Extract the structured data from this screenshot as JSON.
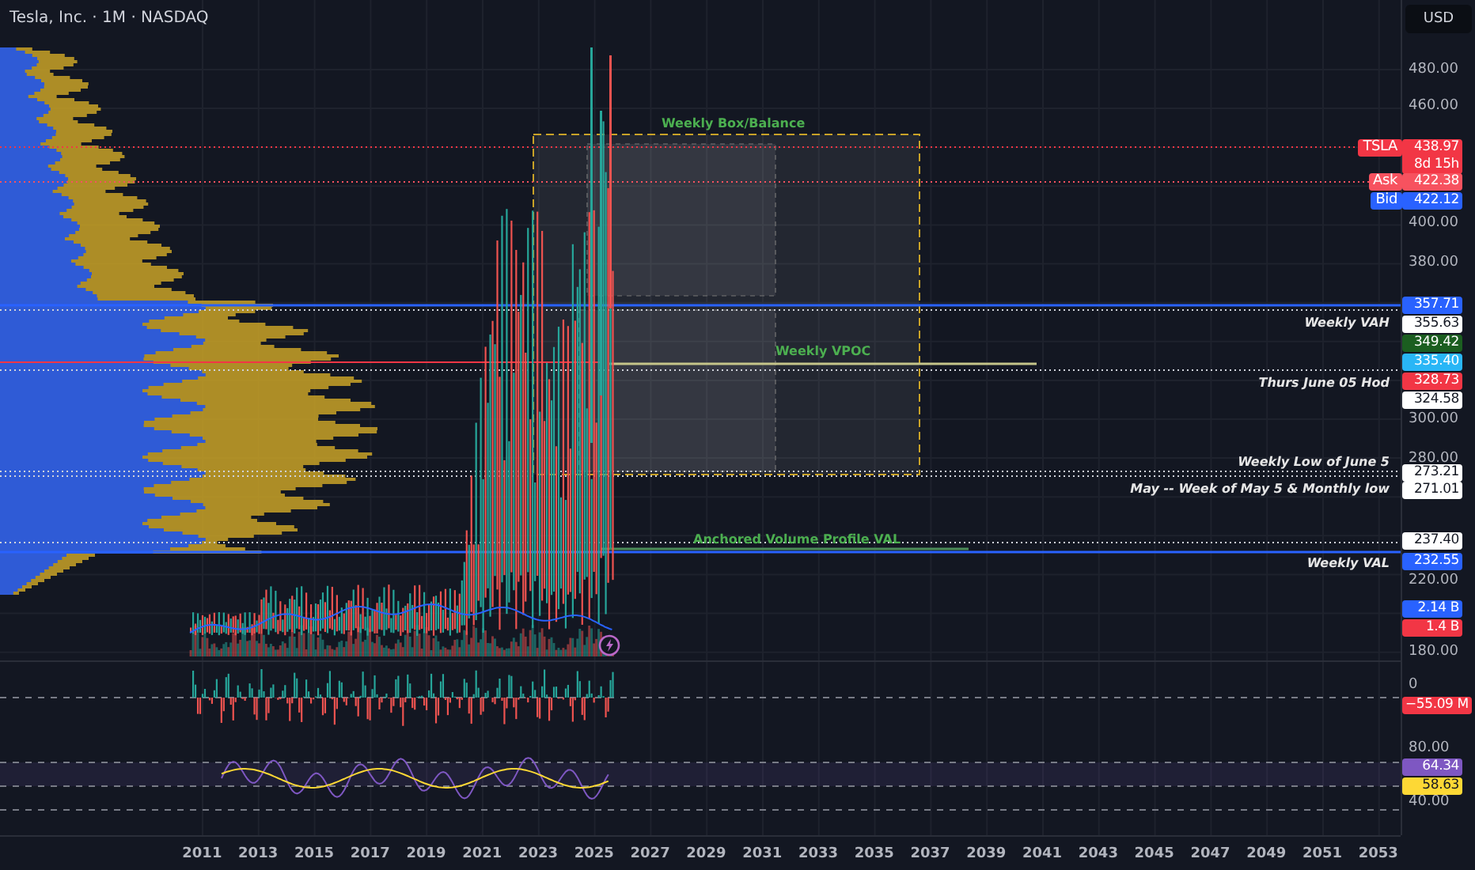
{
  "header": {
    "title": "Tesla, Inc. · 1M · NASDAQ",
    "currency": "USD"
  },
  "price_axis": {
    "ticks": [
      "480.00",
      "460.00",
      "400.00",
      "380.00",
      "300.00",
      "280.00",
      "220.00",
      "180.00",
      "0",
      "80.00",
      "40.00"
    ]
  },
  "price_tags": [
    {
      "label": "TSLA",
      "value": "438.97",
      "sub": "8d 15h",
      "color": "#f23645"
    },
    {
      "label": "Ask",
      "value": "422.38",
      "color": "#f7525f"
    },
    {
      "label": "Bid",
      "value": "422.12",
      "color": "#2962ff"
    },
    {
      "value": "357.71",
      "color": "#2962ff"
    },
    {
      "value": "355.63",
      "color": "#ffffff"
    },
    {
      "value": "349.42",
      "color": "#1b5e20"
    },
    {
      "value": "335.40",
      "color": "#29b6f6"
    },
    {
      "value": "328.73",
      "color": "#f23645"
    },
    {
      "value": "324.58",
      "color": "#ffffff"
    },
    {
      "value": "273.21",
      "color": "#ffffff"
    },
    {
      "value": "271.01",
      "color": "#ffffff"
    },
    {
      "value": "237.40",
      "color": "#ffffff"
    },
    {
      "value": "232.55",
      "color": "#2962ff"
    },
    {
      "value": "2.14 B",
      "color": "#2962ff"
    },
    {
      "value": "1.4 B",
      "color": "#f23645"
    },
    {
      "value": "−55.09 M",
      "color": "#f23645"
    },
    {
      "value": "64.34",
      "color": "#7e57c2"
    },
    {
      "value": "58.63",
      "color": "#fdd835"
    }
  ],
  "level_labels": [
    "Weekly VAH",
    "Thurs June 05 Hod",
    "Weekly Low of June 5",
    "May -- Week of May 5 & Monthly low",
    "Weekly VAL"
  ],
  "chart_labels": [
    "Weekly Box/Balance",
    "Weekly VPOC",
    "Anchored Volume Profile VAL"
  ],
  "time_axis": [
    "2011",
    "2013",
    "2015",
    "2017",
    "2019",
    "2021",
    "2023",
    "2025",
    "2027",
    "2029",
    "2031",
    "2033",
    "2035",
    "2037",
    "2039",
    "2041",
    "2043",
    "2045",
    "2047",
    "2049",
    "2051",
    "2053"
  ]
}
